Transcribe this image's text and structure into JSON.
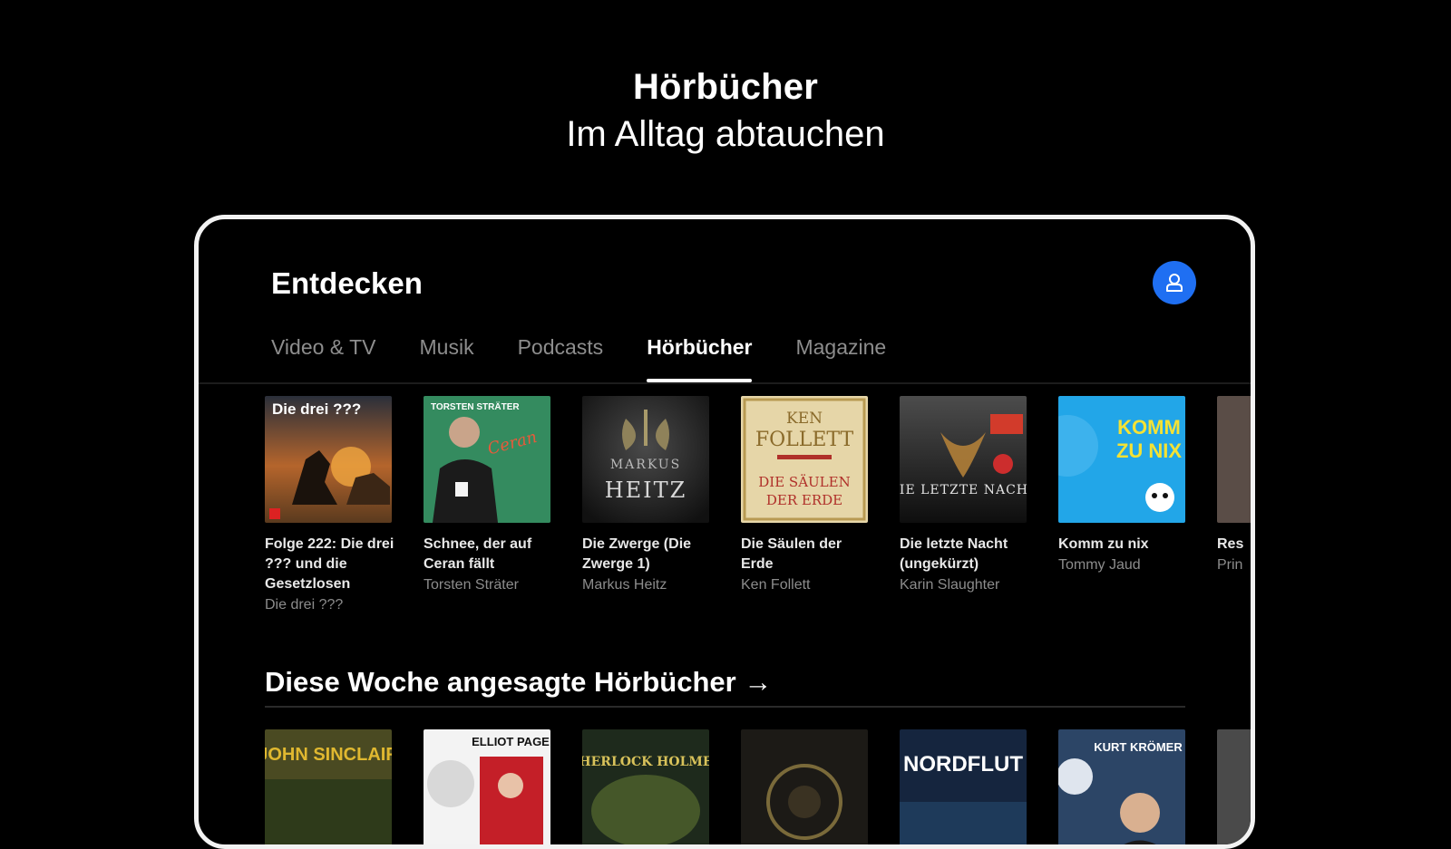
{
  "promo": {
    "title": "Hörbücher",
    "subtitle": "Im Alltag abtauchen"
  },
  "header": {
    "title": "Entdecken",
    "profile_icon": "profile-icon",
    "profile_color": "#1f6ff2"
  },
  "tabs": [
    {
      "label": "Video & TV",
      "active": false
    },
    {
      "label": "Musik",
      "active": false
    },
    {
      "label": "Podcasts",
      "active": false
    },
    {
      "label": "Hörbücher",
      "active": true
    },
    {
      "label": "Magazine",
      "active": false
    }
  ],
  "top_rail": [
    {
      "title": "Folge 222: Die drei ??? und die Gesetzlosen",
      "author": "Die drei ???",
      "cover_text": "Die drei ???"
    },
    {
      "title": "Schnee, der auf Ceran fällt",
      "author": "Torsten Sträter",
      "cover_text": "TORSTEN STRÄTER"
    },
    {
      "title": "Die Zwerge (Die Zwerge 1)",
      "author": "Markus Heitz",
      "cover_text": "MARKUS HEITZ"
    },
    {
      "title": "Die Säulen der Erde",
      "author": "Ken Follett",
      "cover_text": "KEN FOLLETT"
    },
    {
      "title": "Die letzte Nacht (ungekürzt)",
      "author": "Karin Slaughter",
      "cover_text": "DIE LETZTE NACHT"
    },
    {
      "title": "Komm zu nix",
      "author": "Tommy Jaud",
      "cover_text": "KOMM ZU NIX"
    },
    {
      "title": "Res",
      "author": "Prin",
      "cover_text": ""
    }
  ],
  "section": {
    "title": "Diese Woche angesagte Hörbücher →"
  },
  "bottom_rail": [
    {
      "cover_text": "JOHN SINCLAIR"
    },
    {
      "cover_text": "ELLIOT PAGE"
    },
    {
      "cover_text": "SHERLOCK HOLMES"
    },
    {
      "cover_text": ""
    },
    {
      "cover_text": "NORDFLUT"
    },
    {
      "cover_text": "KURT KRÖMER"
    },
    {
      "cover_text": ""
    }
  ]
}
